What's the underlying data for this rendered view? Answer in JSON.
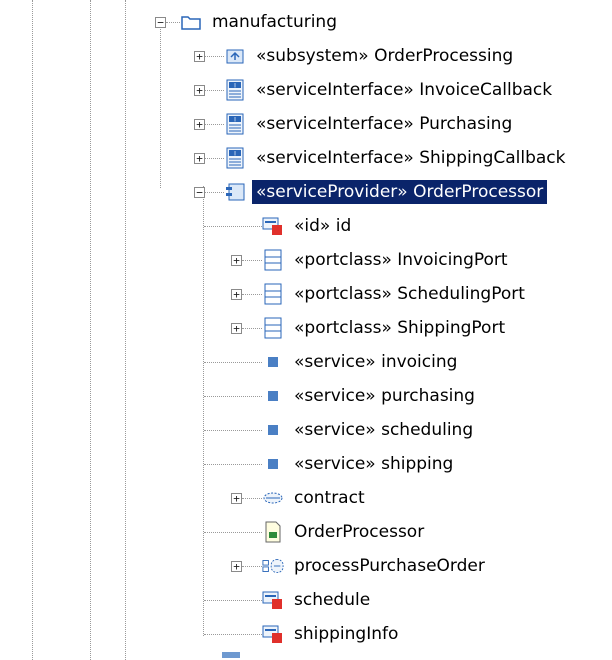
{
  "tree": {
    "root": {
      "label": "manufacturing",
      "icon": "folder-icon"
    },
    "items": [
      {
        "label": "«subsystem» OrderProcessing",
        "icon": "subsystem-icon"
      },
      {
        "label": "«serviceInterface» InvoiceCallback",
        "icon": "interface-icon"
      },
      {
        "label": "«serviceInterface» Purchasing",
        "icon": "interface-icon"
      },
      {
        "label": "«serviceInterface» ShippingCallback",
        "icon": "interface-icon"
      },
      {
        "label": "«serviceProvider» OrderProcessor",
        "icon": "component-icon",
        "selected": true
      },
      {
        "label": "«id» id",
        "icon": "attribute-icon"
      },
      {
        "label": "«portclass» InvoicingPort",
        "icon": "class-icon"
      },
      {
        "label": "«portclass» SchedulingPort",
        "icon": "class-icon"
      },
      {
        "label": "«portclass» ShippingPort",
        "icon": "class-icon"
      },
      {
        "label": "«service» invoicing",
        "icon": "port-icon"
      },
      {
        "label": "«service» purchasing",
        "icon": "port-icon"
      },
      {
        "label": "«service» scheduling",
        "icon": "port-icon"
      },
      {
        "label": "«service» shipping",
        "icon": "port-icon"
      },
      {
        "label": "contract",
        "icon": "collaboration-icon"
      },
      {
        "label": "OrderProcessor",
        "icon": "diagram-icon"
      },
      {
        "label": "processPurchaseOrder",
        "icon": "activity-icon"
      },
      {
        "label": "schedule",
        "icon": "attribute-icon"
      },
      {
        "label": "shippingInfo",
        "icon": "attribute-icon"
      }
    ]
  },
  "colors": {
    "selection": "#0a246a",
    "icon_blue": "#4a7fc4",
    "icon_red": "#e0302b",
    "guide": "#9a9a9a"
  }
}
